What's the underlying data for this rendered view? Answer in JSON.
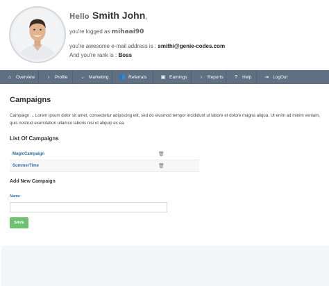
{
  "header": {
    "hello": "Hello",
    "name": "Smith John",
    "comma": ",",
    "logged_prefix": "you're logged as",
    "login": "mihaai90",
    "email_prefix": "you're awesome e-mail address is :",
    "email": "smithi@genie-codes.com",
    "rank_prefix": "And you're rank is :",
    "rank": "Boss"
  },
  "nav": {
    "items": [
      {
        "label": "Overview",
        "icon": "home-icon",
        "glyph": "⌂"
      },
      {
        "label": "Profile",
        "icon": "chevron-right-icon",
        "glyph": "›"
      },
      {
        "label": "Marketing",
        "icon": "chevron-down-icon",
        "glyph": "⌄"
      },
      {
        "label": "Referrals",
        "icon": "users-icon",
        "glyph": "👥"
      },
      {
        "label": "Earnings",
        "icon": "money-icon",
        "glyph": "▣"
      },
      {
        "label": "Reports",
        "icon": "chevron-right-icon",
        "glyph": "›"
      },
      {
        "label": "Help",
        "icon": "help-icon",
        "glyph": "?"
      },
      {
        "label": "LogOut",
        "icon": "logout-icon",
        "glyph": "⇥"
      }
    ]
  },
  "main": {
    "title": "Campaigns",
    "description": "Campaign ... Lorem ipsum dolor sit amet, consectetur adipiscing elit, sed do eiusmod tempor incididunt ut labore et dolore magna aliqua. Ut enim ad minim veniam, quis nostrud exercitation ullamco laboris nisi ut aliquip ex ea",
    "list_title": "List Of Campaigns",
    "campaigns": [
      {
        "name": "MagicCampaign"
      },
      {
        "name": "SummerTime"
      }
    ],
    "add_title": "Add New Campaign",
    "name_label": "Name",
    "name_value": "",
    "save_label": "SAVE"
  },
  "colors": {
    "nav_bg": "#5e7082",
    "link": "#2e6da4",
    "save_button": "#6dc16f",
    "footer_bg": "#f3f6f8"
  }
}
